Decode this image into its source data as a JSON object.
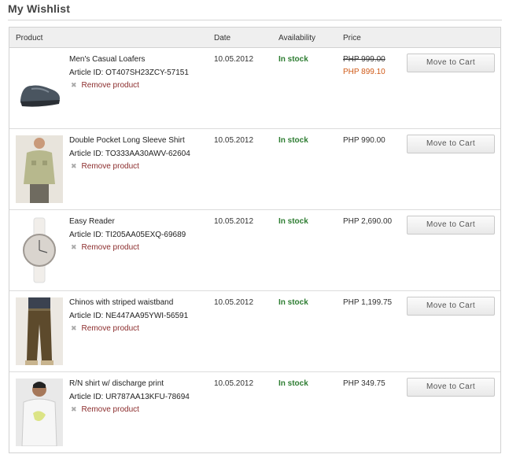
{
  "page": {
    "title": "My Wishlist"
  },
  "table": {
    "headers": {
      "product": "Product",
      "date": "Date",
      "availability": "Availability",
      "price": "Price"
    },
    "rows": [
      {
        "name": "Men's Casual Loafers",
        "article": "Article ID: OT407SH23ZCY-57151",
        "remove": "Remove product",
        "date": "10.05.2012",
        "availability": "In stock",
        "price_old": "PHP 999.00",
        "price": "PHP 899.10",
        "button": "Move to Cart",
        "image_icon": "loafer-shoe-image"
      },
      {
        "name": "Double Pocket Long Sleeve Shirt",
        "article": "Article ID: TO333AA30AWV-62604",
        "remove": "Remove product",
        "date": "10.05.2012",
        "availability": "In stock",
        "price": "PHP 990.00",
        "button": "Move to Cart",
        "image_icon": "shirt-model-image"
      },
      {
        "name": "Easy Reader",
        "article": "Article ID: TI205AA05EXQ-69689",
        "remove": "Remove product",
        "date": "10.05.2012",
        "availability": "In stock",
        "price": "PHP 2,690.00",
        "button": "Move to Cart",
        "image_icon": "wristwatch-image"
      },
      {
        "name": "Chinos with striped waistband",
        "article": "Article ID: NE447AA95YWI-56591",
        "remove": "Remove product",
        "date": "10.05.2012",
        "availability": "In stock",
        "price": "PHP 1,199.75",
        "button": "Move to Cart",
        "image_icon": "chinos-model-image"
      },
      {
        "name": "R/N shirt w/ discharge print",
        "article": "Article ID: UR787AA13KFU-78694",
        "remove": "Remove product",
        "date": "10.05.2012",
        "availability": "In stock",
        "price": "PHP 349.75",
        "button": "Move to Cart",
        "image_icon": "tshirt-model-image"
      }
    ]
  },
  "colors": {
    "in_stock": "#2e7d32",
    "sale_price": "#d05a17",
    "remove_link": "#8b2c2c"
  }
}
